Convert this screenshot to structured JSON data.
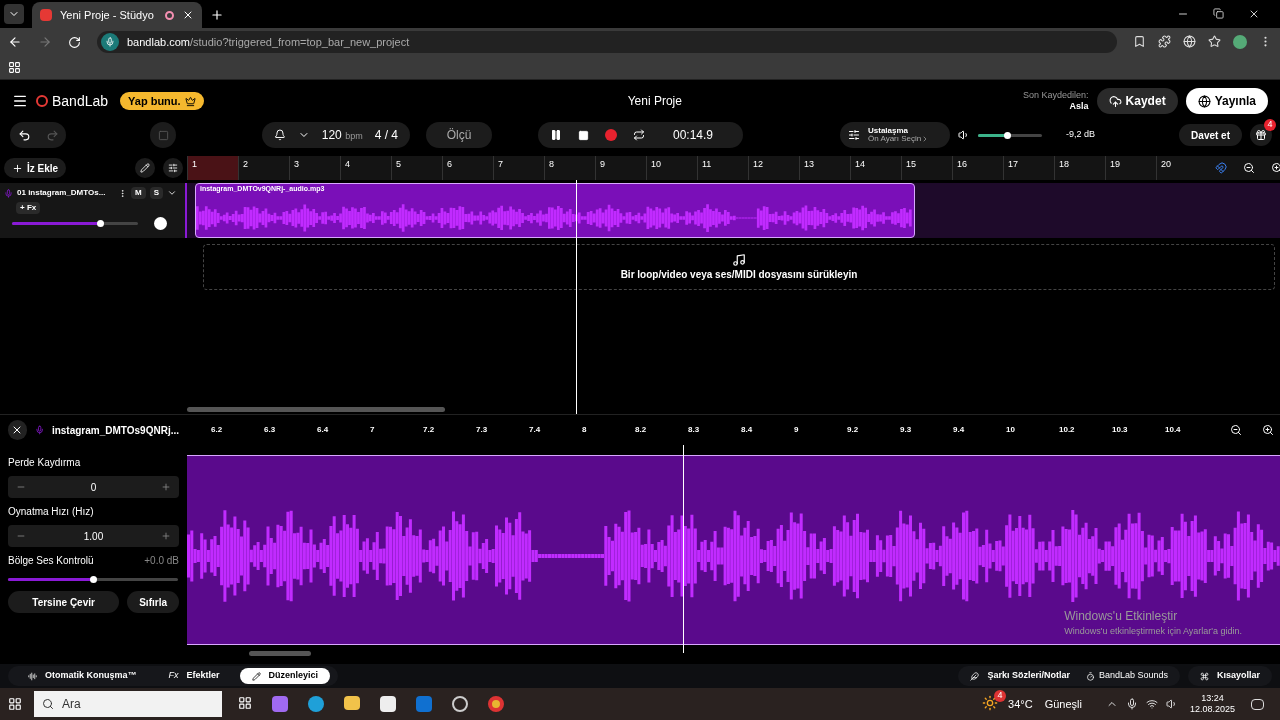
{
  "browser": {
    "tab_title": "Yeni Proje - Stüdyo",
    "url_host": "bandlab.com",
    "url_path": "/studio?triggered_from=top_bar_new_project"
  },
  "header": {
    "brand": "BandLab",
    "promo": "Yap bunu.",
    "project_title": "Yeni Proje",
    "last_saved_label": "Son Kaydedilen:",
    "last_saved_value": "Asla",
    "save_button": "Kaydet",
    "publish_button": "Yayınla"
  },
  "toolbar": {
    "bpm": "120",
    "bpm_unit": "bpm",
    "time_signature": "4 / 4",
    "measure_button": "Ölçü",
    "playing": true,
    "time": "00:14.9",
    "mastering_title": "Ustalaşma",
    "mastering_subtitle": "Ön Ayarı Seçin",
    "volume": {
      "level": 0.45,
      "reading": "-9,2 dB"
    },
    "invite_button": "Davet et",
    "gift_badge": "4"
  },
  "add_track": "İz Ekle",
  "ruler": [
    {
      "label": "1",
      "selected": true
    },
    {
      "label": "2",
      "selected": false
    },
    {
      "label": "3",
      "selected": false
    },
    {
      "label": "4",
      "selected": false
    },
    {
      "label": "5",
      "selected": false
    },
    {
      "label": "6",
      "selected": false
    },
    {
      "label": "7",
      "selected": false
    },
    {
      "label": "8",
      "selected": false
    },
    {
      "label": "9",
      "selected": false
    },
    {
      "label": "10",
      "selected": false
    },
    {
      "label": "11",
      "selected": false
    },
    {
      "label": "12",
      "selected": false
    },
    {
      "label": "13",
      "selected": false
    },
    {
      "label": "14",
      "selected": false
    },
    {
      "label": "15",
      "selected": false
    },
    {
      "label": "16",
      "selected": false
    },
    {
      "label": "17",
      "selected": false
    },
    {
      "label": "18",
      "selected": false
    },
    {
      "label": "19",
      "selected": false
    },
    {
      "label": "20",
      "selected": false
    }
  ],
  "tracks": [
    {
      "number": "01",
      "name": "instagram_DMTOs...",
      "mute": "M",
      "solo": "S",
      "fx": "+ Fx",
      "level": 0.7,
      "clip_name": "instagram_DMTOv9QNRj-_audio.mp3"
    }
  ],
  "drop_zone": "Bir loop/video veya ses/MIDI dosyasını sürükleyin",
  "editor": {
    "title": "instagram_DMTOs9QNRj...",
    "ruler_labels": [
      "6.2",
      "6.3",
      "6.4",
      "7",
      "7.2",
      "7.3",
      "7.4",
      "8",
      "8.2",
      "8.3",
      "8.4",
      "9",
      "9.2",
      "9.3",
      "9.4",
      "10",
      "10.2",
      "10.3",
      "10.4"
    ],
    "pitch_label": "Perde Kaydırma",
    "pitch_value": "0",
    "rate_label": "Oynatma Hızı (Hız)",
    "rate_value": "1.00",
    "gain": {
      "label": "Bölge Ses Kontrolü",
      "reading": "+0.0 dB",
      "level": 0.5
    },
    "reverse_button": "Tersine Çevir",
    "reset_button": "Sıfırla"
  },
  "bottom_tabs": [
    {
      "kind": "speech",
      "label": "Otomatik Konuşma™",
      "selected": false
    },
    {
      "kind": "effects",
      "label": "Efektler",
      "icon_text": "Fx",
      "selected": false
    },
    {
      "kind": "editor",
      "label": "Düzenleyici",
      "selected": true
    }
  ],
  "bottom_right": {
    "lyrics": "Şarkı Sözleri/Notlar",
    "sounds": "BandLab Sounds",
    "shortcuts": "Kısayollar"
  },
  "activation": {
    "title": "Windows'u Etkinleştir",
    "subtitle": "Windows'u etkinleştirmek için Ayarlar'a gidin."
  },
  "taskbar": {
    "search_placeholder": "Ara",
    "weather_badge": "4",
    "temperature": "34°C",
    "weather": "Güneşli",
    "time": "13:24",
    "date": "12.08.2025"
  }
}
